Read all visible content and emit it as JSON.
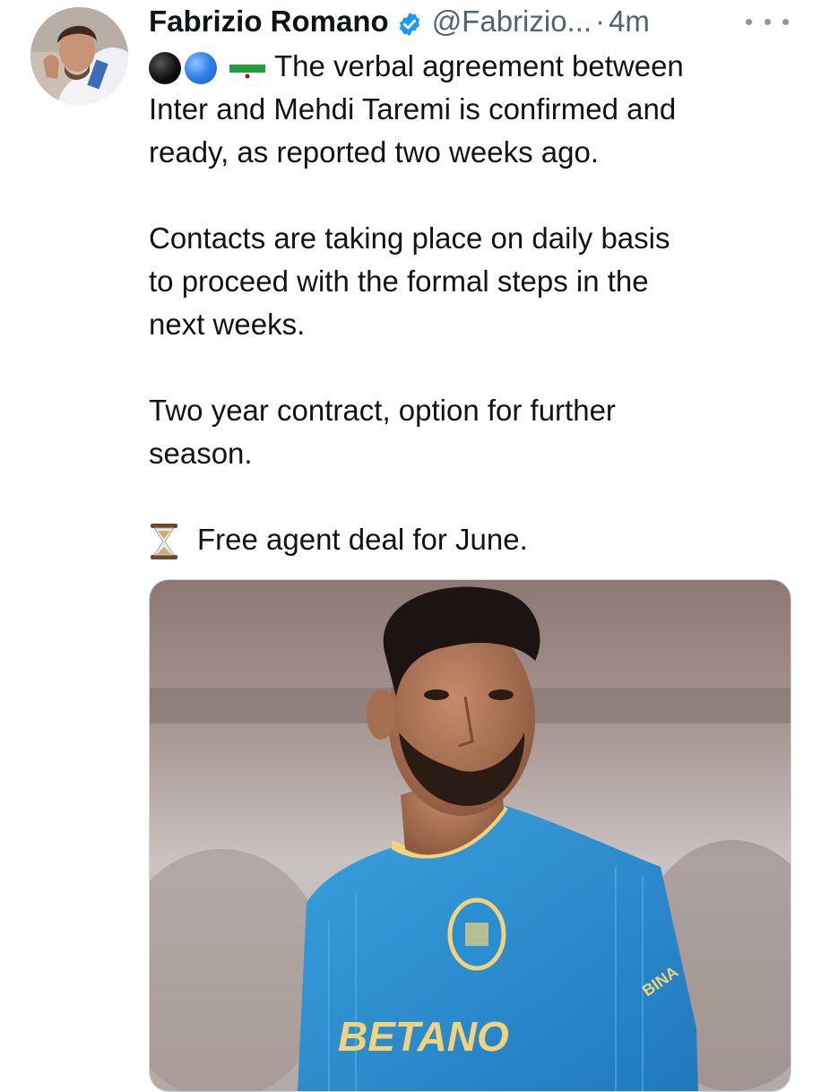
{
  "author": {
    "name": "Fabrizio Romano",
    "handle": "@Fabrizio...",
    "separator": "·",
    "time": "4m"
  },
  "tweet": {
    "lines": [
      "The verbal agreement between",
      "Inter and Mehdi Taremi is confirmed and",
      "ready, as reported two weeks ago.",
      "",
      "Contacts are taking place on daily basis",
      "to proceed with the formal steps in the",
      "next weeks.",
      "",
      "Two year contract, option for further",
      "season.",
      "",
      "Free agent deal for June."
    ],
    "emojis": [
      "black-circle",
      "blue-circle",
      "iran-flag",
      "hourglass"
    ]
  },
  "media": {
    "jersey_sponsor": "BETANO",
    "sleeve_text": "BINA"
  },
  "colors": {
    "text": "#0f1419",
    "muted": "#536471",
    "verified": "#1d9bf0",
    "jersey": "#2a8fd0"
  }
}
